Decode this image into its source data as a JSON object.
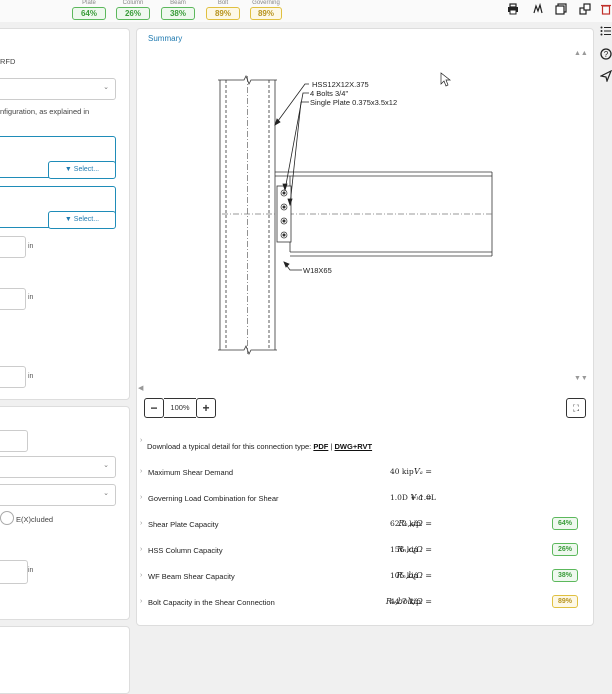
{
  "status_bar": {
    "items": [
      {
        "label": "Plate",
        "value": "64%",
        "status": "green"
      },
      {
        "label": "Column",
        "value": "26%",
        "status": "green"
      },
      {
        "label": "Beam",
        "value": "38%",
        "status": "green"
      },
      {
        "label": "Bolt",
        "value": "89%",
        "status": "yellow"
      },
      {
        "label": "Governing",
        "value": "89%",
        "status": "yellow"
      }
    ]
  },
  "toolbar": {
    "icons": [
      "print-icon",
      "chart-icon",
      "copy-icon",
      "duplicate-icon",
      "delete-icon"
    ]
  },
  "left_panel": {
    "design_method_partial": "RFD",
    "config_text_partial": "nfiguration, as explained in",
    "select_label_1": "Select...",
    "select_label_2": "Select...",
    "unit_in_1": "in",
    "unit_in_2": "in",
    "unit_in_3": "in",
    "unit_in_4": "in",
    "excluded_option": "E(X)cluded"
  },
  "summary": {
    "title": "Summary",
    "zoom_level": "100%",
    "zoom_minus": "−",
    "zoom_plus": "+"
  },
  "drawing": {
    "label_column": "HSS12X12X.375",
    "label_bolts": "4 Bolts 3/4\"",
    "label_plate": "Single Plate 0.375x3.5x12",
    "label_beam": "W18X65"
  },
  "download": {
    "text": "Download a typical detail for this connection type:",
    "pdf": "PDF",
    "sep": "|",
    "dwg": "DWG+RVT"
  },
  "results": [
    {
      "label": "Maximum Shear Demand",
      "formula": "Vₐ =",
      "value": "40 kip",
      "badge": null
    },
    {
      "label": "Governing Load Combination for Shear",
      "formula": "Vₗᴄ =",
      "value": "1.0D + 1.0L",
      "badge": null
    },
    {
      "label": "Shear Plate Capacity",
      "formula": "Rₙ,ₚ/Ω =",
      "value": "62.2 kip",
      "badge": {
        "value": "64%",
        "status": "green"
      }
    },
    {
      "label": "HSS Column Capacity",
      "formula": "Rₙ,c/Ω =",
      "value": "156 kip",
      "badge": {
        "value": "26%",
        "status": "green"
      }
    },
    {
      "label": "WF Beam Shear Capacity",
      "formula": "Rₙ,b/Ω =",
      "value": "105 kip",
      "badge": {
        "value": "38%",
        "status": "green"
      }
    },
    {
      "label": "Bolt Capacity in the Shear Connection",
      "formula": "Rₙ,bolt/Ω =",
      "value": "44.7 kip",
      "badge": {
        "value": "89%",
        "status": "yellow"
      }
    }
  ],
  "colors": {
    "green": "#5cb85c",
    "yellow": "#e0c040",
    "link": "#1f7ab0"
  }
}
